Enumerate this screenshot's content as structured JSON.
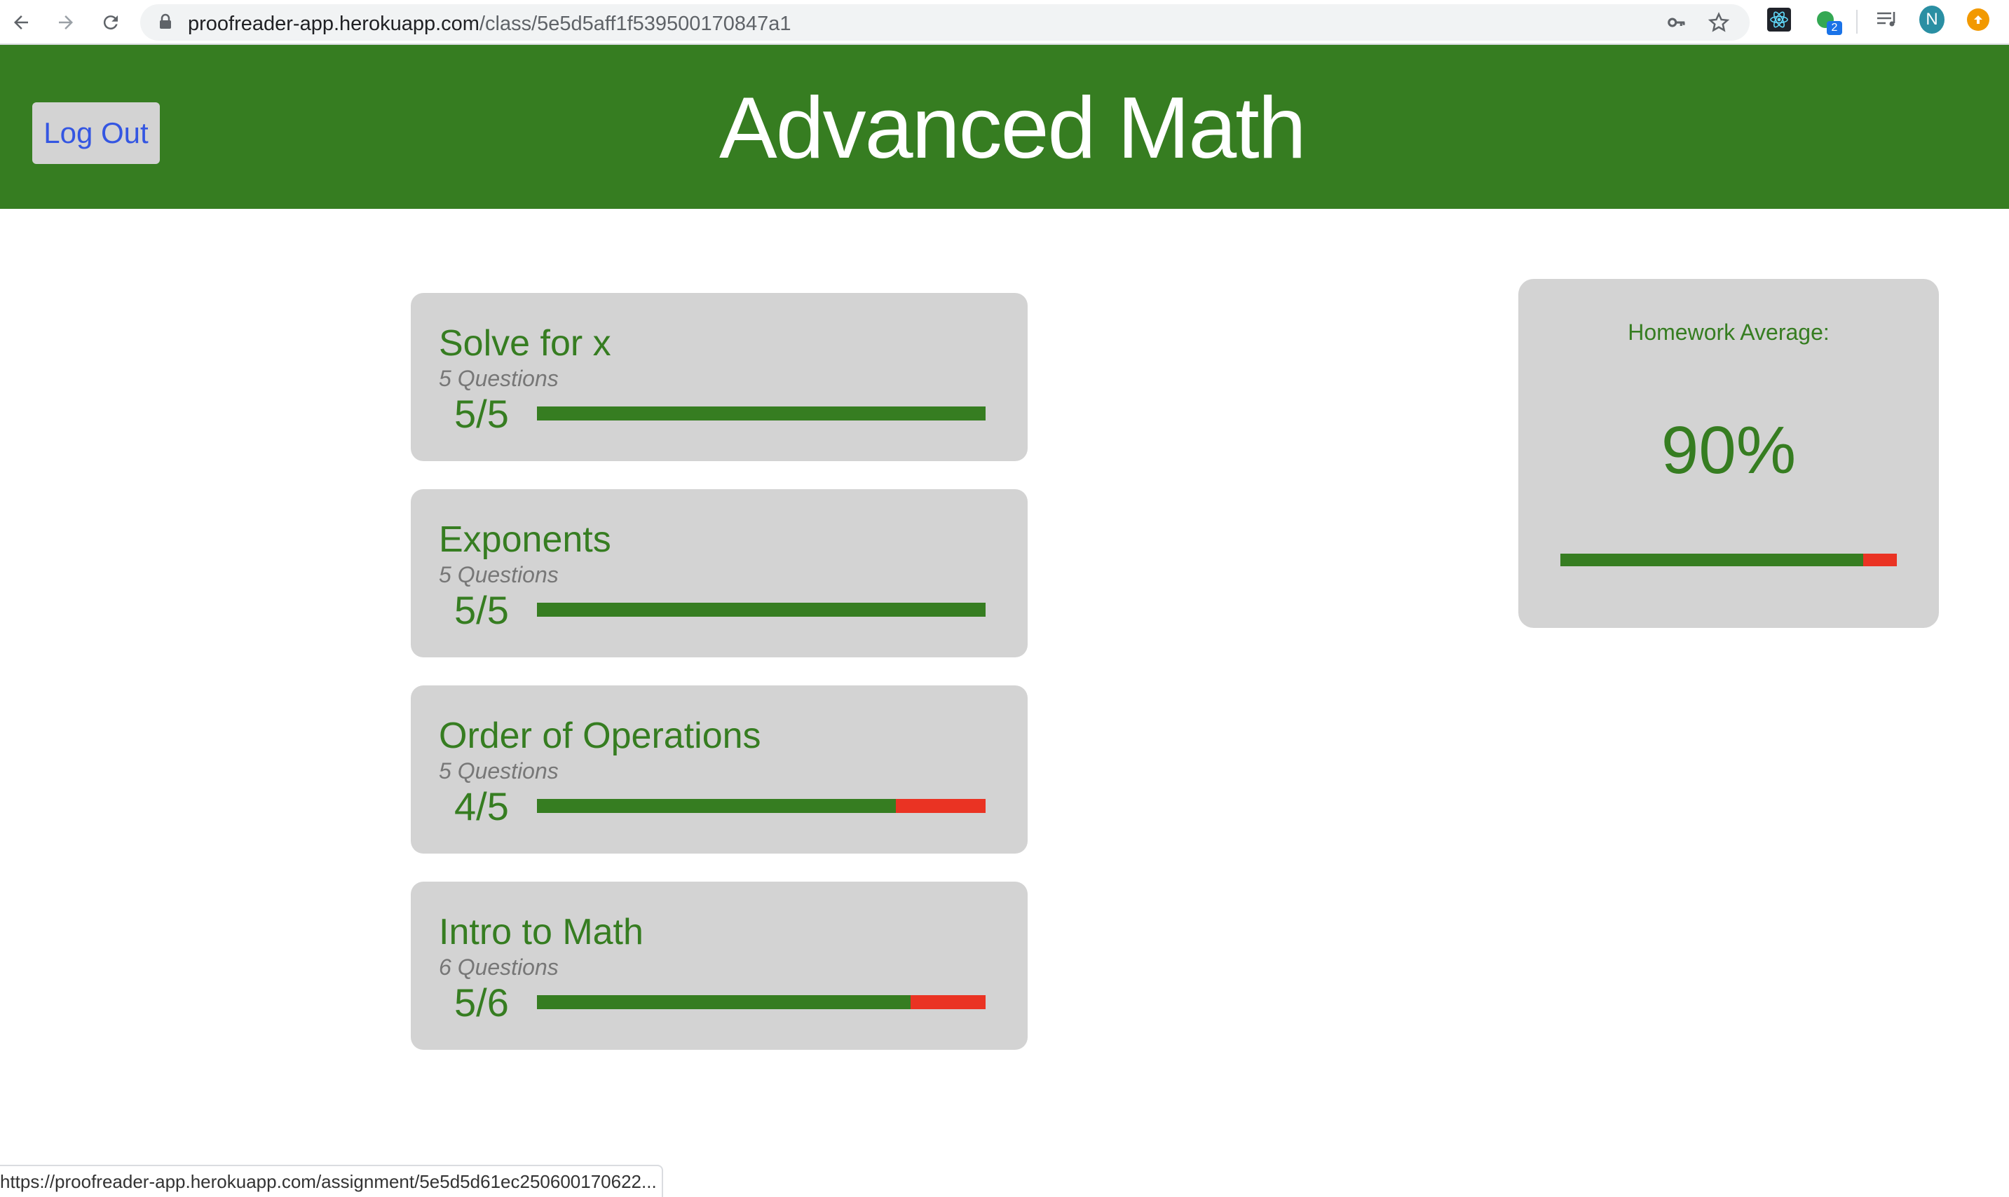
{
  "browser": {
    "url_host": "proofreader-app.herokuapp.com",
    "url_path": "/class/5e5d5aff1f539500170847a1",
    "extension_badge": "2",
    "profile_initial": "N",
    "status_url": "https://proofreader-app.herokuapp.com/assignment/5e5d5d61ec250600170622..."
  },
  "header": {
    "title": "Advanced Math",
    "logout_label": "Log Out",
    "color": "#367d21"
  },
  "assignments": [
    {
      "title": "Solve for x",
      "questions": "5 Questions",
      "score": "5/5",
      "correct": 5,
      "total": 5
    },
    {
      "title": "Exponents",
      "questions": "5 Questions",
      "score": "5/5",
      "correct": 5,
      "total": 5
    },
    {
      "title": "Order of Operations",
      "questions": "5 Questions",
      "score": "4/5",
      "correct": 4,
      "total": 5
    },
    {
      "title": "Intro to Math",
      "questions": "6 Questions",
      "score": "5/6",
      "correct": 5,
      "total": 6
    }
  ],
  "average": {
    "label": "Homework Average:",
    "value": "90%",
    "fraction": 0.9
  },
  "colors": {
    "correct": "#367d21",
    "incorrect": "#ea3323",
    "card": "#d3d3d3"
  }
}
